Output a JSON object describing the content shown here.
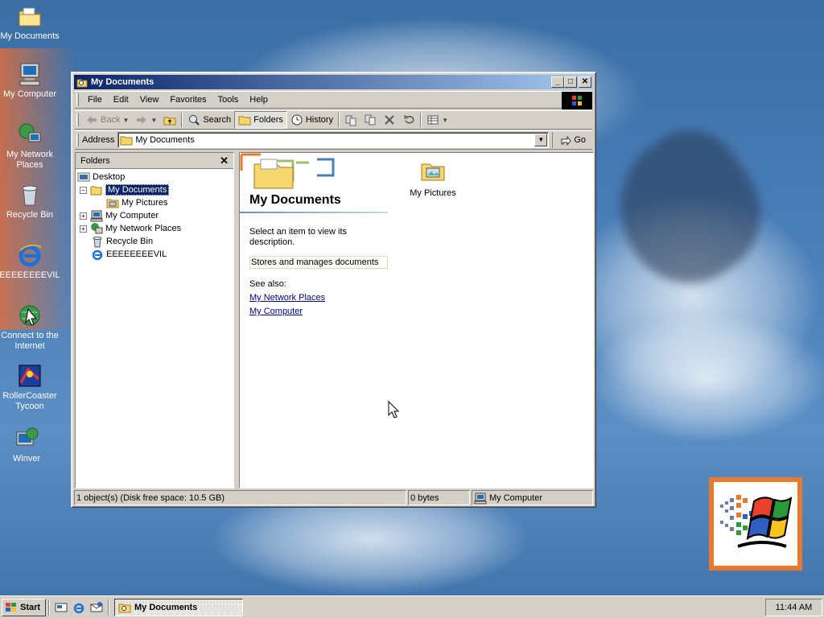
{
  "desktop": {
    "icons": [
      {
        "label": "My Documents",
        "icon": "my-documents-folder-icon"
      },
      {
        "label": "My Computer",
        "icon": "my-computer-icon"
      },
      {
        "label": "My Network Places",
        "icon": "network-places-icon"
      },
      {
        "label": "Recycle Bin",
        "icon": "recycle-bin-icon"
      },
      {
        "label": "EEEEEEEEVIL",
        "icon": "internet-explorer-icon"
      },
      {
        "label": "Connect to the Internet",
        "icon": "connect-internet-icon"
      },
      {
        "label": "RollerCoaster Tycoon",
        "icon": "rollercoaster-tycoon-icon"
      },
      {
        "label": "Winver",
        "icon": "winver-icon"
      }
    ]
  },
  "window": {
    "title": "My Documents",
    "buttons": {
      "minimize": "_",
      "maximize": "□",
      "close": "✕"
    },
    "menu": [
      "File",
      "Edit",
      "View",
      "Favorites",
      "Tools",
      "Help"
    ],
    "toolbar": {
      "back": "Back",
      "search": "Search",
      "folders": "Folders",
      "history": "History"
    },
    "address": {
      "label": "Address",
      "value": "My Documents",
      "go": "Go"
    },
    "folders_pane": {
      "title": "Folders",
      "close": "✕",
      "tree": [
        {
          "label": "Desktop"
        },
        {
          "label": "My Documents",
          "expander": "−"
        },
        {
          "label": "My Pictures"
        },
        {
          "label": "My Computer",
          "expander": "+"
        },
        {
          "label": "My Network Places",
          "expander": "+"
        },
        {
          "label": "Recycle Bin"
        },
        {
          "label": "EEEEEEEEVIL"
        }
      ]
    },
    "content": {
      "heading": "My Documents",
      "description": "Select an item to view its description.",
      "info": "Stores and manages documents",
      "see_also": "See also:",
      "links": [
        "My Network Places",
        "My Computer"
      ],
      "items": [
        {
          "label": "My Pictures",
          "icon": "my-pictures-folder-icon"
        }
      ]
    },
    "status": {
      "objects": "1 object(s) (Disk free space: 10.5 GB)",
      "size": "0 bytes",
      "zone": "My Computer"
    }
  },
  "taskbar": {
    "start": "Start",
    "task": "My Documents",
    "clock": "11:44 AM"
  },
  "colors": {
    "title_active": "#0a246a",
    "title_gradient_end": "#a6caf0",
    "face": "#d4d0c8",
    "desktop": "#3a6ea5",
    "link": "#000080"
  }
}
